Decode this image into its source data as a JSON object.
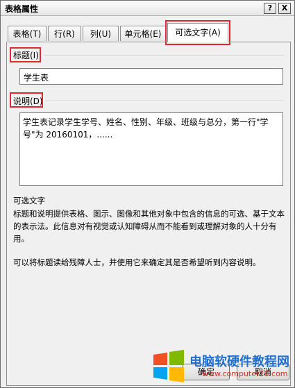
{
  "window": {
    "title": "表格属性",
    "help_label": "?",
    "close_label": "X"
  },
  "tabs": [
    {
      "label": "表格(T)"
    },
    {
      "label": "行(R)"
    },
    {
      "label": "列(U)"
    },
    {
      "label": "单元格(E)"
    },
    {
      "label": "可选文字(A)",
      "active": true
    }
  ],
  "title_section": {
    "label": "标题(I)",
    "value": "学生表"
  },
  "description_section": {
    "label": "说明(D)",
    "value": "学生表记录学生学号、姓名、性别、年级、班级与总分，第一行\"学号\"为 20160101，......"
  },
  "help": {
    "heading": "可选文字",
    "paragraph1": "标题和说明提供表格、图示、图像和其他对象中包含的信息的可选、基于文本的表示法。此信息对有视觉或认知障碍从而不能看到或理解对象的人十分有用。",
    "paragraph2": "可以将标题读给残障人士，并使用它来确定其是否希望听到内容说明。"
  },
  "buttons": {
    "ok": "确定",
    "cancel": "取消"
  },
  "watermark": {
    "line1": "电脑软硬件教程网",
    "line2": "www.computer26.com"
  },
  "colors": {
    "highlight": "#e2272e",
    "watermark_text": "#1f6fd0"
  }
}
